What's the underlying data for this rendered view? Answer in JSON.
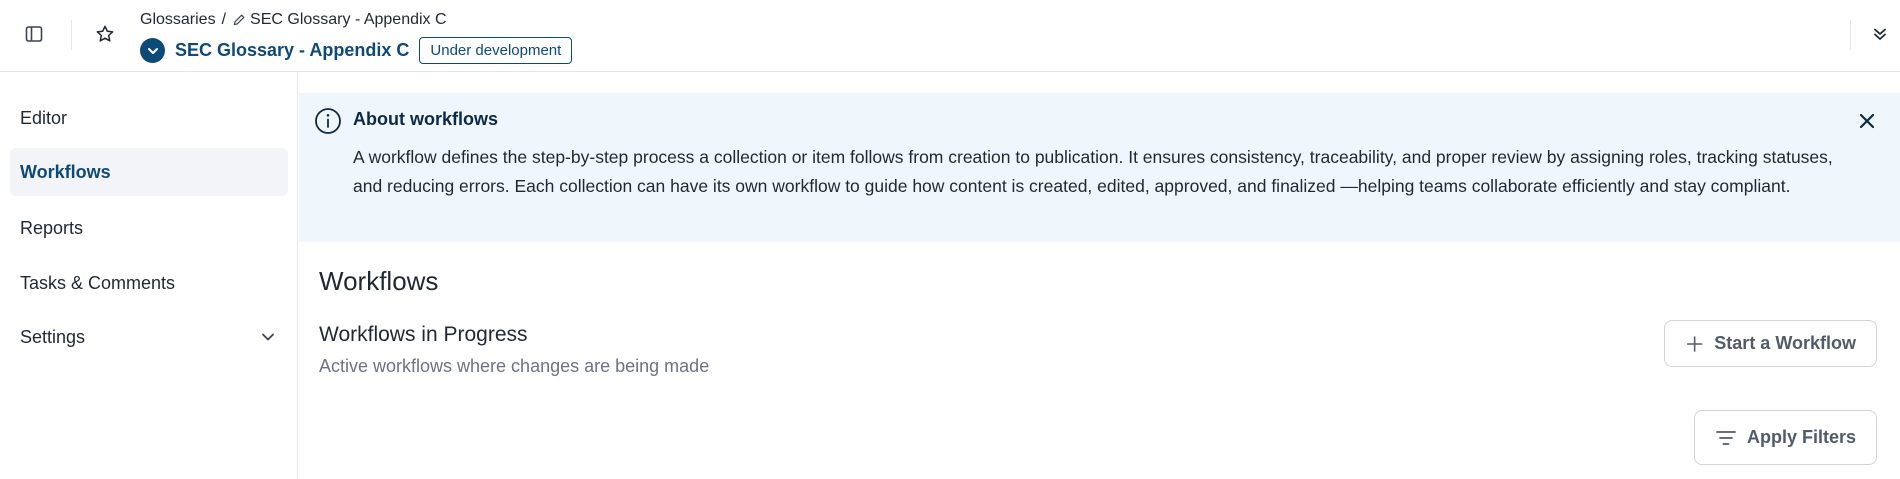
{
  "breadcrumb": {
    "root": "Glossaries",
    "separator": "/",
    "current": "SEC Glossary - Appendix C"
  },
  "header": {
    "title": "SEC Glossary - Appendix C",
    "status": "Under development"
  },
  "sidebar": {
    "items": [
      {
        "label": "Editor"
      },
      {
        "label": "Workflows",
        "active": true
      },
      {
        "label": "Reports"
      },
      {
        "label": "Tasks & Comments"
      },
      {
        "label": "Settings",
        "has_submenu": true
      }
    ]
  },
  "banner": {
    "title": "About workflows",
    "body": "A workflow defines the step-by-step process a collection or item follows from creation to publication. It ensures consistency, traceability, and proper review by assigning roles, tracking statuses, and reducing errors. Each collection can have its own workflow to guide how content is created, edited, approved, and finalized —helping teams collaborate efficiently and stay compliant."
  },
  "main": {
    "title": "Workflows",
    "section_title": "Workflows in Progress",
    "section_subtitle": "Active workflows where changes are being made",
    "start_button": "Start a Workflow",
    "filter_button": "Apply Filters"
  },
  "icons": {
    "sidebar_toggle": "sidebar-toggle-icon",
    "favorite": "star-icon",
    "collapse": "double-chevron-down-icon",
    "title_chevron": "chevron-down-circle-icon",
    "edit": "pencil-icon",
    "info": "info-icon",
    "close": "close-icon",
    "plus": "plus-icon",
    "filter": "filter-lines-icon"
  },
  "colors": {
    "brand": "#0d4a78",
    "banner_bg": "#eff6fc",
    "active_nav_bg": "#f2f4f7"
  }
}
